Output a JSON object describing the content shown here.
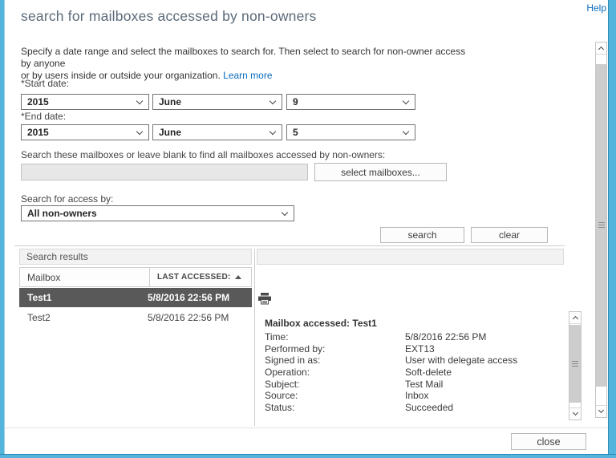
{
  "help_link": "Help",
  "title": "search for mailboxes accessed by non-owners",
  "description": {
    "line1": "Specify a date range and select the mailboxes to search for. Then select to search for non-owner access by anyone",
    "line2": "or by users inside or outside your organization.",
    "learn_more": "Learn more"
  },
  "start_date": {
    "label": "*Start date:",
    "year": "2015",
    "month": "June",
    "day": "9"
  },
  "end_date": {
    "label": "*End date:",
    "year": "2015",
    "month": "June",
    "day": "5"
  },
  "mailboxes": {
    "label": "Search these mailboxes or leave blank to find all mailboxes accessed by non-owners:",
    "input_value": "",
    "select_button": "select mailboxes..."
  },
  "access_by": {
    "label": "Search for access by:",
    "value": "All non-owners"
  },
  "actions": {
    "search": "search",
    "clear": "clear",
    "close": "close"
  },
  "results": {
    "header": "Search results",
    "columns": {
      "mailbox": "Mailbox",
      "last_accessed": "LAST ACCESSED:"
    },
    "sort": "ascending",
    "rows": [
      {
        "mailbox": "Test1",
        "last_accessed": "5/8/2016 22:56 PM",
        "selected": true
      },
      {
        "mailbox": "Test2",
        "last_accessed": "5/8/2016 22:56 PM",
        "selected": false
      }
    ]
  },
  "details": {
    "title": "Mailbox accessed: Test1",
    "fields": [
      {
        "label": "Time:",
        "value": "5/8/2016 22:56 PM"
      },
      {
        "label": "Performed by:",
        "value": "EXT13"
      },
      {
        "label": "Signed in as:",
        "value": "User with delegate access"
      },
      {
        "label": "Operation:",
        "value": "Soft-delete"
      },
      {
        "label": "Subject:",
        "value": "Test Mail"
      },
      {
        "label": "Source:",
        "value": "Inbox"
      },
      {
        "label": "Status:",
        "value": "Succeeded"
      }
    ]
  },
  "colors": {
    "window_border": "#54b4dc",
    "link": "#0a6cbd",
    "selected_row_bg": "#595959",
    "title_text": "#5b6a79"
  }
}
